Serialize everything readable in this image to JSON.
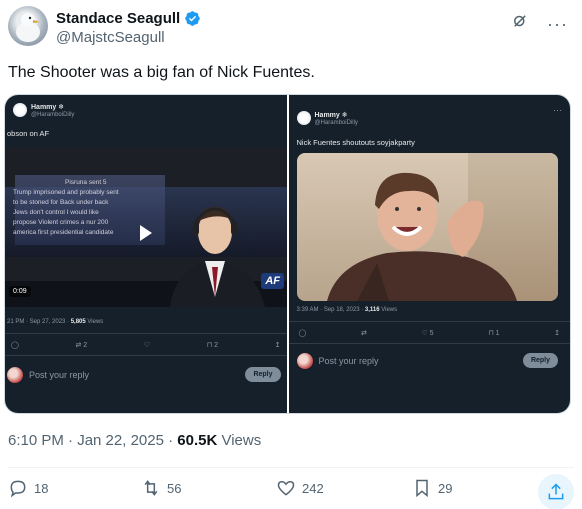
{
  "author": {
    "display_name": "Standace Seagull",
    "handle": "@MajstcSeagull",
    "verified": true
  },
  "tweet": {
    "text": "The Shooter was a big fan of Nick Fuentes."
  },
  "media": [
    {
      "name": "Hammy ❄",
      "handle": "@HaramboiDilly",
      "text": "obson on AF",
      "video_ticker": [
        "Pisruna sent 5",
        "Trump imprisoned and probably sent",
        "to be stoned for Back under back",
        "Jews don't control I would like",
        "propose Violent crimes a nur 200",
        "america first presidential candidate"
      ],
      "video_time": "0:09",
      "channel_badge": "AF",
      "meta_time": "21 PM · Sep 27, 2023 · ",
      "meta_views": "5,805",
      "meta_views_label": " Views",
      "counts": {
        "retweets": "2",
        "bookmarks": "2"
      },
      "reply_placeholder": "Post your reply",
      "reply_button": "Reply"
    },
    {
      "name": "Hammy ❄",
      "handle": "@HaramboiDilly",
      "text": "Nick Fuentes shoutouts soyjakparty",
      "meta_time": "3:39 AM · Sep 18, 2023 · ",
      "meta_views": "3,116",
      "meta_views_label": " Views",
      "counts": {
        "likes": "5",
        "bookmarks": "1"
      },
      "reply_placeholder": "Post your reply",
      "reply_button": "Reply"
    }
  ],
  "footer": {
    "time": "6:10 PM · Jan 22, 2025 · ",
    "views": "60.5K",
    "views_label": " Views"
  },
  "actions": {
    "replies": "18",
    "reposts": "56",
    "likes": "242",
    "bookmarks": "29"
  },
  "colors": {
    "verified": "#1d9bf0",
    "dark_bg": "#15202b",
    "muted": "#536471",
    "share_accent": "#1d9bf0"
  }
}
